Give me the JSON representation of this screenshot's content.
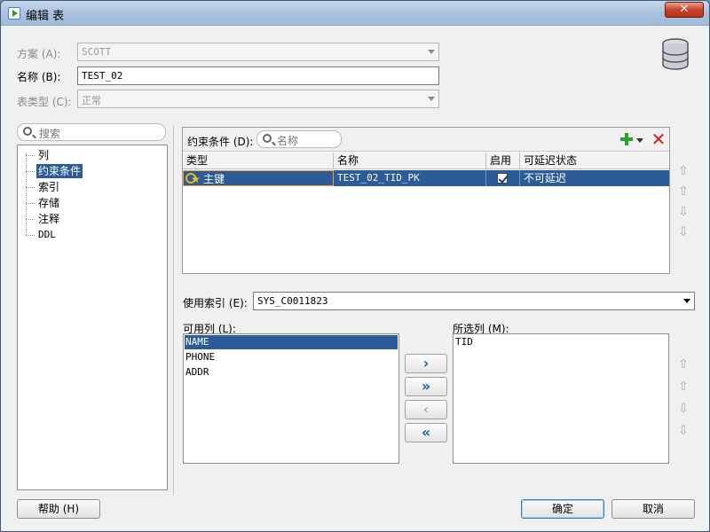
{
  "window": {
    "title": "编辑 表",
    "close": "✕"
  },
  "form": {
    "schema_label": "方案 (A):",
    "schema_value": "SCOTT",
    "name_label": "名称 (B):",
    "name_value": "TEST_02",
    "table_type_label": "表类型 (C):",
    "table_type_value": "正常"
  },
  "sidebar": {
    "search_placeholder": "搜索",
    "items": [
      {
        "label": "列"
      },
      {
        "label": "约束条件",
        "selected": true
      },
      {
        "label": "索引"
      },
      {
        "label": "存储"
      },
      {
        "label": "注释"
      },
      {
        "label": "DDL"
      }
    ]
  },
  "constraints": {
    "label": "约束条件 (D):",
    "search_placeholder": "名称",
    "columns": [
      "类型",
      "名称",
      "启用",
      "可延迟状态"
    ],
    "rows": [
      {
        "type": "主键",
        "name": "TEST_02_TID_PK",
        "enabled": true,
        "deferrable": "不可延迟"
      }
    ]
  },
  "index": {
    "label": "使用索引 (E):",
    "value": "SYS_C0011823"
  },
  "available": {
    "label": "可用列 (L):",
    "items": [
      "NAME",
      "PHONE",
      "ADDR"
    ],
    "selected_index": 0
  },
  "selected": {
    "label": "所选列 (M):",
    "items": [
      "TID"
    ]
  },
  "move_buttons": [
    "›",
    "»",
    "‹",
    "«"
  ],
  "buttons": {
    "help": "帮助 (H)",
    "ok": "确定",
    "cancel": "取消"
  },
  "icons": {
    "reorder": [
      "move-top-icon",
      "move-up-icon",
      "move-down-icon",
      "move-bottom-icon"
    ]
  }
}
